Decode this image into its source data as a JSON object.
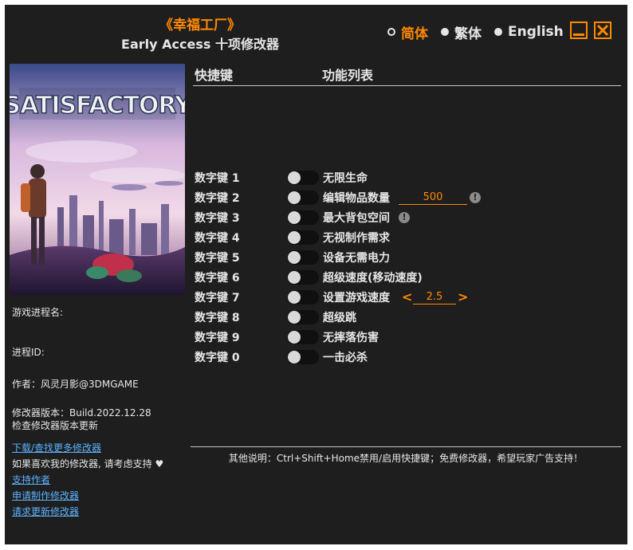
{
  "header": {
    "game_title": "《幸福工厂》",
    "sub_title": "Early Access 十项修改器"
  },
  "languages": [
    {
      "label": "简体",
      "active": true
    },
    {
      "label": "繁体",
      "active": false
    },
    {
      "label": "English",
      "active": false
    }
  ],
  "cover": {
    "logo_text": "SATISFACTORY"
  },
  "info": {
    "process_name_label": "游戏进程名:",
    "process_id_label": "进程ID:",
    "author": "作者：风灵月影@3DMGAME",
    "version": "修改器版本：Build.2022.12.28",
    "check_update": "检查修改器版本更新",
    "download_more": "下载/查找更多修改器",
    "support_text": "如果喜欢我的修改器, 请考虑支持",
    "heart": "♥",
    "support_author": "支持作者",
    "request_trainer": "申请制作修改器",
    "request_update": "请求更新修改器"
  },
  "table": {
    "col_hotkey": "快捷键",
    "col_function": "功能列表",
    "rows": [
      {
        "hotkey": "数字键 1",
        "label": "无限生命"
      },
      {
        "hotkey": "数字键 2",
        "label": "编辑物品数量",
        "value": "500",
        "warn": "!"
      },
      {
        "hotkey": "数字键 3",
        "label": "最大背包空间",
        "warn": "!"
      },
      {
        "hotkey": "数字键 4",
        "label": "无视制作需求"
      },
      {
        "hotkey": "数字键 5",
        "label": "设备无需电力"
      },
      {
        "hotkey": "数字键 6",
        "label": "超级速度(移动速度)"
      },
      {
        "hotkey": "数字键 7",
        "label": "设置游戏速度",
        "value": "2.5",
        "left_arrow": "<",
        "right_arrow": ">"
      },
      {
        "hotkey": "数字键 8",
        "label": "超级跳"
      },
      {
        "hotkey": "数字键 9",
        "label": "无摔落伤害"
      },
      {
        "hotkey": "数字键 0",
        "label": "一击必杀"
      }
    ]
  },
  "footer": {
    "note": "其他说明：Ctrl+Shift+Home禁用/启用快捷键；免费修改器，希望玩家广告支持！"
  },
  "colors": {
    "accent": "#ff8a00",
    "background": "#1e1e1e",
    "text": "#e6e6e6",
    "link": "#5cb3ff"
  }
}
